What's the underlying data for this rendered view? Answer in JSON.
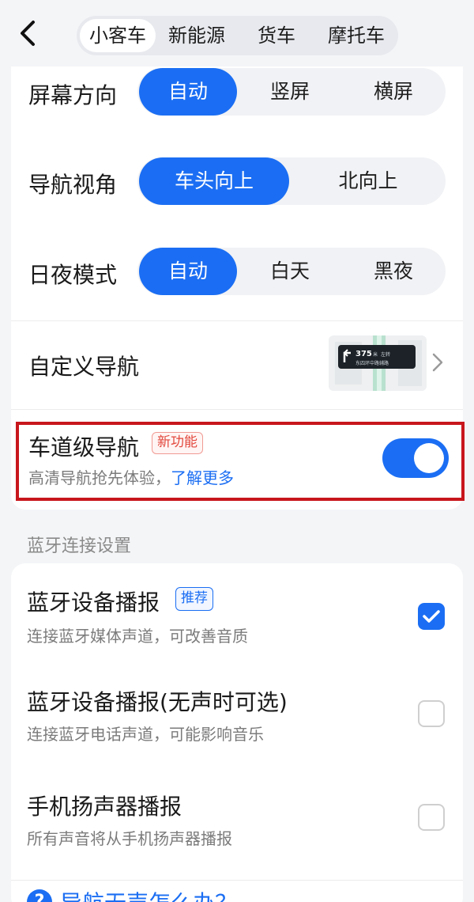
{
  "header": {
    "tabs": [
      "小客车",
      "新能源",
      "货车",
      "摩托车"
    ],
    "active_tab": "小客车"
  },
  "settings": {
    "screen_orientation": {
      "label": "屏幕方向",
      "options": [
        "自动",
        "竖屏",
        "横屏"
      ],
      "selected": "自动"
    },
    "nav_view": {
      "label": "导航视角",
      "options": [
        "车头向上",
        "北向上"
      ],
      "selected": "车头向上"
    },
    "day_night": {
      "label": "日夜模式",
      "options": [
        "自动",
        "白天",
        "黑夜"
      ],
      "selected": "自动"
    },
    "custom_nav": {
      "label": "自定义导航",
      "thumb_distance": "375",
      "thumb_unit": "米",
      "thumb_direction": "左转",
      "thumb_road": "东四环中路辅路"
    },
    "lane_nav": {
      "label": "车道级导航",
      "badge": "新功能",
      "subtitle": "高清导航抢先体验，",
      "link": "了解更多",
      "enabled": true
    }
  },
  "bluetooth": {
    "section_title": "蓝牙连接设置",
    "items": [
      {
        "title": "蓝牙设备播报",
        "badge": "推荐",
        "subtitle": "连接蓝牙媒体声道，可改善音质",
        "checked": true
      },
      {
        "title": "蓝牙设备播报(无声时可选)",
        "subtitle": "连接蓝牙电话声道，可能影响音乐",
        "checked": false
      },
      {
        "title": "手机扬声器播报",
        "subtitle": "所有声音将从手机扬声器播报",
        "checked": false
      }
    ]
  },
  "help": {
    "text": "导航无声怎么办？"
  },
  "colors": {
    "accent": "#1b6ef3",
    "highlight_border": "#c8161d",
    "new_badge": "#e2483d"
  }
}
